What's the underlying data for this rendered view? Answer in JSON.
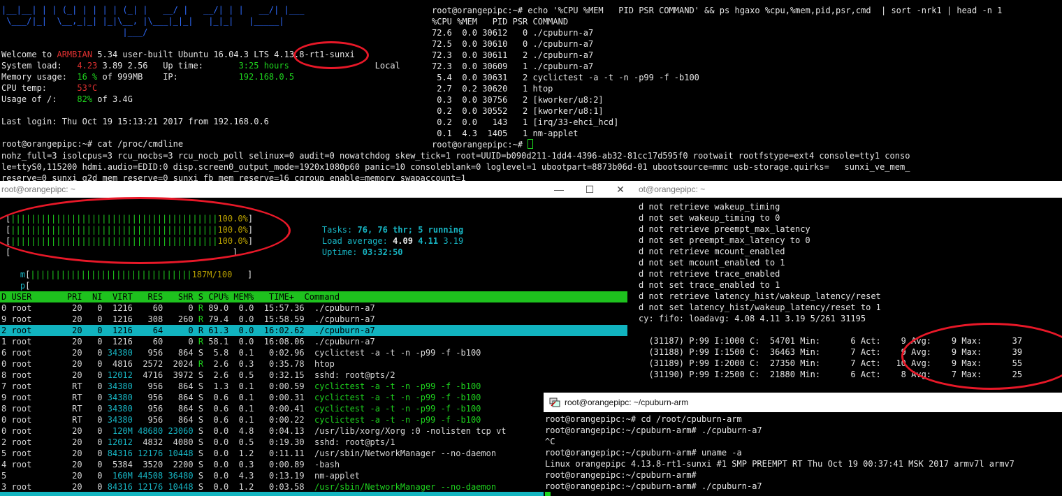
{
  "colors": {
    "accent_green": "#1ed41e",
    "accent_red": "#e03030",
    "accent_cyan": "#17b4c2",
    "selection": "#11b3bf",
    "annotation": "#e81828"
  },
  "top_left": {
    "lines": [
      {
        "t": "|__|__| | | (_| | | | | (_| |   __/ |   __/| | |   __/| |___",
        "c": "blu"
      },
      {
        "t": " \\___/|_|  \\__,_|_| |_|\\__, |\\___|_|_|   |_|_|   |_____|",
        "c": "blu"
      },
      {
        "t": "                        |___/",
        "c": "blu"
      },
      {
        "t": "",
        "c": ""
      },
      {
        "segs": [
          [
            "Welcome to ",
            "wht"
          ],
          [
            "ARMBIAN",
            "red"
          ],
          [
            " 5.34 user-built Ubuntu 16.04.3 LTS 4.13.8-rt1-sunxi",
            "wht"
          ]
        ]
      },
      {
        "segs": [
          [
            "System load:   ",
            "wht"
          ],
          [
            "4.23",
            "red"
          ],
          [
            " 3.89 2.56   Up time:       ",
            "wht"
          ],
          [
            "3:25 hours",
            "grn"
          ],
          [
            "                 Local",
            "wht"
          ]
        ]
      },
      {
        "segs": [
          [
            "Memory usage:  ",
            "wht"
          ],
          [
            "16 %",
            "grn"
          ],
          [
            " of 999MB    IP:            ",
            "wht"
          ],
          [
            "192.168.0.5",
            "grn"
          ]
        ]
      },
      {
        "segs": [
          [
            "CPU temp:      ",
            "wht"
          ],
          [
            "53°C",
            "red"
          ]
        ]
      },
      {
        "segs": [
          [
            "Usage of /:    ",
            "wht"
          ],
          [
            "82%",
            "grn"
          ],
          [
            " of 3.4G",
            "wht"
          ]
        ]
      },
      {
        "t": "",
        "c": ""
      },
      {
        "t": "Last login: Thu Oct 19 15:13:21 2017 from 192.168.0.6",
        "c": "wht"
      },
      {
        "t": "",
        "c": ""
      },
      {
        "t": "root@orangepipc:~# cat /proc/cmdline",
        "c": "wht"
      },
      {
        "t": "nohz_full=3 isolcpus=3 rcu_nocbs=3 rcu_nocb_poll selinux=0 audit=0 nowatchdog skew_tick=1 root=UUID=b090d211-1dd4-4396-ab32-81cc17d595f0 rootwait rootfstype=ext4 console=tty1 conso",
        "c": "wht"
      },
      {
        "t": "le=ttyS0,115200 hdmi.audio=EDID:0 disp.screen0_output_mode=1920x1080p60 panic=10 consoleblank=0 loglevel=1 ubootpart=8873b06d-01 ubootsource=mmc usb-storage.quirks=   sunxi_ve_mem_",
        "c": "wht"
      },
      {
        "t": "reserve=0 sunxi_g2d_mem_reserve=0 sunxi_fb_mem_reserve=16 cgroup_enable=memory swapaccount=1",
        "c": "wht"
      }
    ]
  },
  "top_right": {
    "lines": [
      "root@orangepipc:~# echo '%CPU %MEM   PID PSR COMMAND' && ps hgaxo %cpu,%mem,pid,psr,cmd  | sort -nrk1 | head -n 1",
      "%CPU %MEM   PID PSR COMMAND",
      "72.6  0.0 30612   0 ./cpuburn-a7",
      "72.5  0.0 30610   0 ./cpuburn-a7",
      "72.3  0.0 30611   2 ./cpuburn-a7",
      "72.3  0.0 30609   1 ./cpuburn-a7",
      " 5.4  0.0 30631   2 cyclictest -a -t -n -p99 -f -b100",
      " 2.7  0.2 30620   1 htop",
      " 0.3  0.0 30756   2 [kworker/u8:2]",
      " 0.2  0.0 30552   2 [kworker/u8:1]",
      " 0.2  0.0   143   1 [irq/33-ehci_hcd]",
      " 0.1  4.3  1405   1 nm-applet"
    ],
    "prompt": "root@orangepipc:~# "
  },
  "htop_window": {
    "title": "root@orangepipc: ~",
    "btn_min": "—",
    "btn_max": "☐",
    "btn_close": "✕",
    "cpu_bars": [
      {
        "open": "[",
        "bars": "|||||||||||||||||||||||||||||||||||||||||",
        "value": "100.0%",
        "close": "]"
      },
      {
        "open": "[",
        "bars": "|||||||||||||||||||||||||||||||||||||||||",
        "value": "100.0%",
        "close": "]"
      },
      {
        "open": "[",
        "bars": "|||||||||||||||||||||||||||||||||||||||||",
        "value": "100.0%",
        "close": "]"
      },
      {
        "open": "[",
        "bars": "",
        "value": "",
        "close": "]"
      }
    ],
    "mem_bar": {
      "label": "m",
      "open": "[",
      "bars": "||||||||||||||||||||||||||||||||",
      "value": "187M/100",
      "close": "]"
    },
    "swp_bar": {
      "label": "p",
      "open": "[",
      "close": "]"
    },
    "tasks_label": "Tasks:",
    "tasks_value": "76, 76 thr; 5 running",
    "load_label": "Load average:",
    "load_1": "4.09",
    "load_5": "4.11",
    "load_15": "3.19",
    "uptime_label": "Uptime:",
    "uptime_value": "03:32:50",
    "header": "D USER       PRI  NI  VIRT   RES   SHR S CPU% MEM%   TIME+  Command",
    "rows": [
      {
        "pid": "0",
        "user": "root",
        "pri": "20",
        "ni": "0",
        "virt": "1216",
        "res": "60",
        "shr": "0",
        "s": "R",
        "cpu": "89.0",
        "mem": "0.0",
        "time": "15:57.36",
        "cmd": "./cpuburn-a7",
        "sel": false,
        "cmdc": ""
      },
      {
        "pid": "9",
        "user": "root",
        "pri": "20",
        "ni": "0",
        "virt": "1216",
        "res": "308",
        "shr": "260",
        "s": "R",
        "cpu": "79.4",
        "mem": "0.0",
        "time": "15:58.59",
        "cmd": "./cpuburn-a7",
        "sel": false,
        "cmdc": ""
      },
      {
        "pid": "2",
        "user": "root",
        "pri": "20",
        "ni": "0",
        "virt": "1216",
        "res": "64",
        "shr": "0",
        "s": "R",
        "cpu": "61.3",
        "mem": "0.0",
        "time": "16:02.62",
        "cmd": "./cpuburn-a7",
        "sel": true,
        "cmdc": ""
      },
      {
        "pid": "1",
        "user": "root",
        "pri": "20",
        "ni": "0",
        "virt": "1216",
        "res": "60",
        "shr": "0",
        "s": "R",
        "cpu": "58.1",
        "mem": "0.0",
        "time": "16:08.06",
        "cmd": "./cpuburn-a7",
        "sel": false,
        "cmdc": ""
      },
      {
        "pid": "6",
        "user": "root",
        "pri": "20",
        "ni": "0",
        "virt": "34380",
        "res": "956",
        "shr": "864",
        "s": "S",
        "cpu": "5.8",
        "mem": "0.1",
        "time": "0:02.96",
        "cmd": "cyclictest -a -t -n -p99 -f -b100",
        "sel": false,
        "cmdc": ""
      },
      {
        "pid": "0",
        "user": "root",
        "pri": "20",
        "ni": "0",
        "virt": "4816",
        "res": "2572",
        "shr": "2024",
        "s": "R",
        "cpu": "2.6",
        "mem": "0.3",
        "time": "0:35.78",
        "cmd": "htop",
        "sel": false,
        "cmdc": ""
      },
      {
        "pid": "8",
        "user": "root",
        "pri": "20",
        "ni": "0",
        "virt": "12012",
        "res": "4716",
        "shr": "3972",
        "s": "S",
        "cpu": "2.6",
        "mem": "0.5",
        "time": "0:32.15",
        "cmd": "sshd: root@pts/2",
        "sel": false,
        "cmdc": ""
      },
      {
        "pid": "7",
        "user": "root",
        "pri": "RT",
        "ni": "0",
        "virt": "34380",
        "res": "956",
        "shr": "864",
        "s": "S",
        "cpu": "1.3",
        "mem": "0.1",
        "time": "0:00.59",
        "cmd": "cyclictest -a -t -n -p99 -f -b100",
        "sel": false,
        "cmdc": "grn"
      },
      {
        "pid": "9",
        "user": "root",
        "pri": "RT",
        "ni": "0",
        "virt": "34380",
        "res": "956",
        "shr": "864",
        "s": "S",
        "cpu": "0.6",
        "mem": "0.1",
        "time": "0:00.31",
        "cmd": "cyclictest -a -t -n -p99 -f -b100",
        "sel": false,
        "cmdc": "grn"
      },
      {
        "pid": "8",
        "user": "root",
        "pri": "RT",
        "ni": "0",
        "virt": "34380",
        "res": "956",
        "shr": "864",
        "s": "S",
        "cpu": "0.6",
        "mem": "0.1",
        "time": "0:00.41",
        "cmd": "cyclictest -a -t -n -p99 -f -b100",
        "sel": false,
        "cmdc": "grn"
      },
      {
        "pid": "0",
        "user": "root",
        "pri": "RT",
        "ni": "0",
        "virt": "34380",
        "res": "956",
        "shr": "864",
        "s": "S",
        "cpu": "0.6",
        "mem": "0.1",
        "time": "0:00.22",
        "cmd": "cyclictest -a -t -n -p99 -f -b100",
        "sel": false,
        "cmdc": "grn"
      },
      {
        "pid": "0",
        "user": "root",
        "pri": "20",
        "ni": "0",
        "virt": "120M",
        "res": "48680",
        "shr": "23060",
        "s": "S",
        "cpu": "0.0",
        "mem": "4.8",
        "time": "0:04.13",
        "cmd": "/usr/lib/xorg/Xorg :0 -nolisten tcp vt",
        "sel": false,
        "cmdc": ""
      },
      {
        "pid": "2",
        "user": "root",
        "pri": "20",
        "ni": "0",
        "virt": "12012",
        "res": "4832",
        "shr": "4080",
        "s": "S",
        "cpu": "0.0",
        "mem": "0.5",
        "time": "0:19.30",
        "cmd": "sshd: root@pts/1",
        "sel": false,
        "cmdc": ""
      },
      {
        "pid": "5",
        "user": "root",
        "pri": "20",
        "ni": "0",
        "virt": "84316",
        "res": "12176",
        "shr": "10448",
        "s": "S",
        "cpu": "0.0",
        "mem": "1.2",
        "time": "0:11.11",
        "cmd": "/usr/sbin/NetworkManager --no-daemon",
        "sel": false,
        "cmdc": ""
      },
      {
        "pid": "4",
        "user": "root",
        "pri": "20",
        "ni": "0",
        "virt": "5384",
        "res": "3520",
        "shr": "2200",
        "s": "S",
        "cpu": "0.0",
        "mem": "0.3",
        "time": "0:00.89",
        "cmd": "-bash",
        "sel": false,
        "cmdc": ""
      },
      {
        "pid": "5",
        "user": "",
        "pri": "20",
        "ni": "0",
        "virt": "160M",
        "res": "44508",
        "shr": "36480",
        "s": "S",
        "cpu": "0.0",
        "mem": "4.3",
        "time": "0:13.19",
        "cmd": "nm-applet",
        "sel": false,
        "cmdc": ""
      },
      {
        "pid": "3",
        "user": "root",
        "pri": "20",
        "ni": "0",
        "virt": "84316",
        "res": "12176",
        "shr": "10448",
        "s": "S",
        "cpu": "0.0",
        "mem": "1.2",
        "time": "0:03.58",
        "cmd": "/usr/sbin/NetworkManager --no-daemon",
        "sel": false,
        "cmdc": "grn"
      }
    ]
  },
  "cyclic_window": {
    "title": "ot@orangepipc: ~",
    "lines": [
      "d not retrieve wakeup_timing",
      "d not set wakeup_timing to 0",
      "d not retrieve preempt_max_latency",
      "d not set preempt_max_latency to 0",
      "d not retrieve mcount_enabled",
      "d not set mcount_enabled to 1",
      "d not retrieve trace_enabled",
      "d not set trace_enabled to 1",
      "d not retrieve latency_hist/wakeup_latency/reset",
      "d not set latency_hist/wakeup_latency/reset to 1",
      "cy: fifo: loadavg: 4.08 4.11 3.19 5/261 31195",
      "",
      "  (31187) P:99 I:1000 C:  54701 Min:      6 Act:    9 Avg:    9 Max:      37",
      "  (31188) P:99 I:1500 C:  36463 Min:      7 Act:    9 Avg:    9 Max:      39",
      "  (31189) P:99 I:2000 C:  27350 Min:      7 Act:   10 Avg:    9 Max:      55",
      "  (31190) P:99 I:2500 C:  21880 Min:      6 Act:    8 Avg:    7 Max:      25"
    ]
  },
  "cpuburn_window": {
    "title": "root@orangepipc: ~/cpuburn-arm",
    "lines": [
      "root@orangepipc:~# cd /root/cpuburn-arm",
      "root@orangepipc:~/cpuburn-arm# ./cpuburn-a7",
      "^C",
      "root@orangepipc:~/cpuburn-arm# uname -a",
      "Linux orangepipc 4.13.8-rt1-sunxi #1 SMP PREEMPT RT Thu Oct 19 00:37:41 MSK 2017 armv7l armv7",
      "root@orangepipc:~/cpuburn-arm# ",
      "root@orangepipc:~/cpuburn-arm# ./cpuburn-a7"
    ]
  }
}
